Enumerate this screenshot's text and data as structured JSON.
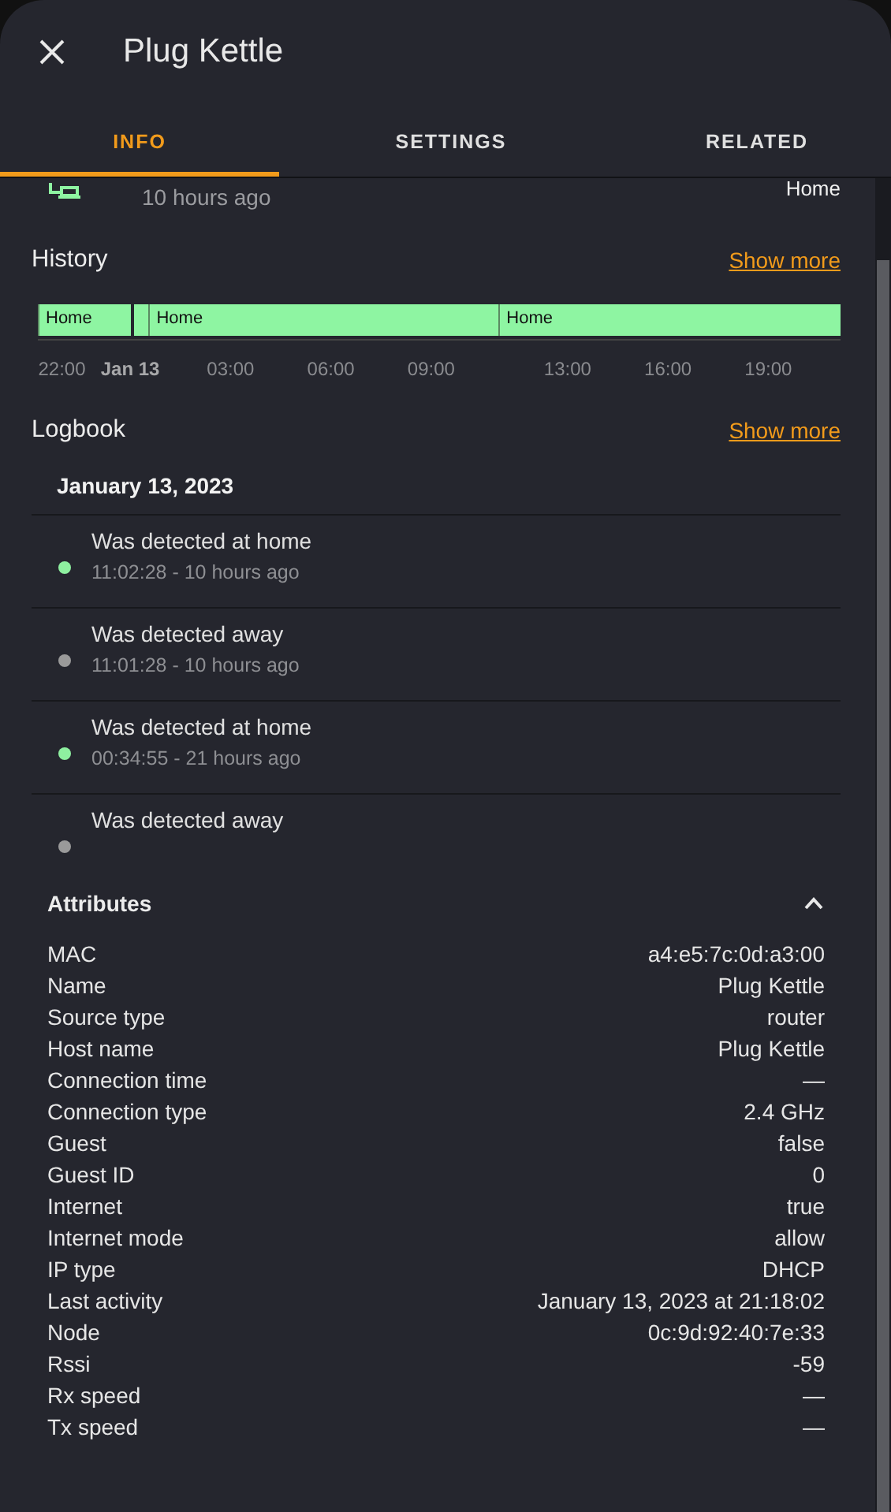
{
  "dialog": {
    "title": "Plug Kettle"
  },
  "tabs": [
    {
      "label": "INFO",
      "selected": true
    },
    {
      "label": "SETTINGS",
      "selected": false
    },
    {
      "label": "RELATED",
      "selected": false
    }
  ],
  "entity": {
    "last_changed": "10 hours ago",
    "state": "Home"
  },
  "history": {
    "title": "History",
    "link": "Show more",
    "segments": [
      {
        "kind": "state",
        "label": "Home"
      },
      {
        "kind": "gap"
      },
      {
        "kind": "state",
        "label": "Home"
      },
      {
        "kind": "state",
        "label": "Home"
      }
    ],
    "ticks": [
      {
        "label": "22:00",
        "bold": false
      },
      {
        "label": "Jan 13",
        "bold": true
      },
      {
        "label": "03:00",
        "bold": false
      },
      {
        "label": "06:00",
        "bold": false
      },
      {
        "label": "09:00",
        "bold": false
      },
      {
        "label": "13:00",
        "bold": false
      },
      {
        "label": "16:00",
        "bold": false
      },
      {
        "label": "19:00",
        "bold": false
      }
    ]
  },
  "logbook": {
    "title": "Logbook",
    "link": "Show more",
    "date": "January 13, 2023",
    "entries": [
      {
        "message": "Was detected at home",
        "time": "11:02:28 - 10 hours ago",
        "color": "#8ef0a0"
      },
      {
        "message": "Was detected away",
        "time": "11:01:28 - 10 hours ago",
        "color": "#9a9a9a"
      },
      {
        "message": "Was detected at home",
        "time": "00:34:55 - 21 hours ago",
        "color": "#8ef0a0"
      },
      {
        "message": "Was detected away",
        "color": "#9a9a9a"
      }
    ]
  },
  "attributes": {
    "title": "Attributes",
    "expanded": true,
    "rows": [
      {
        "name": "MAC",
        "value": "a4:e5:7c:0d:a3:00"
      },
      {
        "name": "Name",
        "value": "Plug Kettle"
      },
      {
        "name": "Source type",
        "value": "router"
      },
      {
        "name": "Host name",
        "value": "Plug Kettle"
      },
      {
        "name": "Connection time",
        "value": "—"
      },
      {
        "name": "Connection type",
        "value": "2.4 GHz"
      },
      {
        "name": "Guest",
        "value": "false"
      },
      {
        "name": "Guest ID",
        "value": "0"
      },
      {
        "name": "Internet",
        "value": "true"
      },
      {
        "name": "Internet mode",
        "value": "allow"
      },
      {
        "name": "IP type",
        "value": "DHCP"
      },
      {
        "name": "Last activity",
        "value": "January 13, 2023 at 21:18:02"
      },
      {
        "name": "Node",
        "value": "0c:9d:92:40:7e:33"
      },
      {
        "name": "Rssi",
        "value": "-59"
      },
      {
        "name": "Rx speed",
        "value": "—"
      },
      {
        "name": "Tx speed",
        "value": "—"
      }
    ]
  }
}
